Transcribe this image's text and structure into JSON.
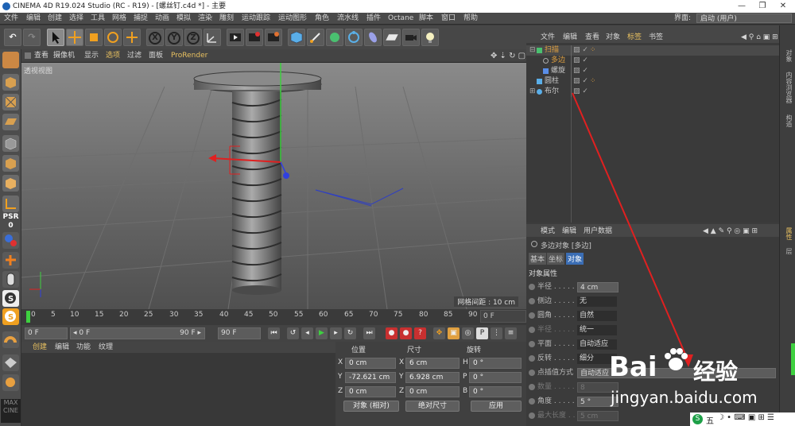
{
  "titlebar": {
    "title": "CINEMA 4D R19.024 Studio (RC - R19) - [螺丝钉.c4d *] - 主要",
    "minimize": "—",
    "maximize": "❐",
    "close": "✕"
  },
  "menu": [
    "文件",
    "编辑",
    "创建",
    "选择",
    "工具",
    "网格",
    "捕捉",
    "动画",
    "模拟",
    "渲染",
    "雕刻",
    "运动跟踪",
    "运动图形",
    "角色",
    "流水线",
    "插件",
    "Octane",
    "脚本",
    "窗口",
    "帮助"
  ],
  "layout": {
    "label": "界面:",
    "value": "启动 (用户)"
  },
  "toolbar": {
    "undo": "↶",
    "redo": "↷",
    "x": "X",
    "y": "Y",
    "z": "Z"
  },
  "viewport": {
    "menu": [
      "查看",
      "摄像机",
      "显示",
      "选项",
      "过滤",
      "面板",
      "ProRender"
    ],
    "label": "透视视图",
    "grid_info": "网格间距 : 10 cm"
  },
  "lefttools": {
    "psr": "PSR",
    "zero": "0"
  },
  "timeline": {
    "ticks": [
      "0",
      "5",
      "10",
      "15",
      "20",
      "25",
      "30",
      "35",
      "40",
      "45",
      "50",
      "55",
      "60",
      "65",
      "70",
      "75",
      "80",
      "85",
      "90"
    ],
    "current": "0 F"
  },
  "transport": {
    "start": "0 F",
    "range_start": "◂ 0 F",
    "range_end": "90 F ▸",
    "end": "90 F"
  },
  "material": {
    "tabs": [
      "创建",
      "编辑",
      "功能",
      "纹理"
    ]
  },
  "coords": {
    "headers": {
      "position": "位置",
      "size": "尺寸",
      "rotation": "旋转"
    },
    "rows": [
      {
        "axis": "X",
        "pos": "0 cm",
        "saxis": "X",
        "size": "6 cm",
        "raxis": "H",
        "rot": "0 °"
      },
      {
        "axis": "Y",
        "pos": "-72.621 cm",
        "saxis": "Y",
        "size": "6.928 cm",
        "raxis": "P",
        "rot": "0 °"
      },
      {
        "axis": "Z",
        "pos": "0 cm",
        "saxis": "Z",
        "size": "0 cm",
        "raxis": "B",
        "rot": "0 °"
      }
    ],
    "mode": "对象 (相对)",
    "size_mode": "绝对尺寸",
    "apply": "应用"
  },
  "objmgr": {
    "tabs": [
      "文件",
      "编辑",
      "查看",
      "对象",
      "标签",
      "书签"
    ],
    "objects": [
      {
        "name": "扫描",
        "indent": 0,
        "color": "#e0a040"
      },
      {
        "name": "多边",
        "indent": 1,
        "color": "#e0a040"
      },
      {
        "name": "螺旋",
        "indent": 1,
        "color": "#c8c8c8"
      },
      {
        "name": "圆柱",
        "indent": 0,
        "color": "#c8c8c8"
      },
      {
        "name": "布尔",
        "indent": 0,
        "color": "#c8c8c8"
      }
    ]
  },
  "attr": {
    "tabs": [
      "模式",
      "编辑",
      "用户数据"
    ],
    "object_title": "多边对象 [多边]",
    "sub_tabs": [
      "基本",
      "坐标",
      "对象"
    ],
    "section": "对象属性",
    "rows": [
      {
        "label": "半径 . . . . . .",
        "value": "4 cm",
        "field": true
      },
      {
        "label": "侧边 . . . . . .",
        "value": "无",
        "field": false
      },
      {
        "label": "圆角 . . . . . .",
        "value": "自然",
        "field": false
      },
      {
        "label": "半径 . . . . . .",
        "value": "统一",
        "field": false
      },
      {
        "label": "平面 . . . . . .",
        "value": "自动适应",
        "field": false
      },
      {
        "label": "反转 . . . . . .",
        "value": "细分",
        "field": false
      },
      {
        "label": "点插值方式",
        "value": "自动适应",
        "field": true
      },
      {
        "label": "数量 . . . . . .",
        "value": "8",
        "field": true
      },
      {
        "label": "角度 . . . . . .",
        "value": "5 °",
        "field": true
      },
      {
        "label": "最大长度 . . .",
        "value": "5 cm",
        "field": true
      }
    ]
  },
  "rightstrip": [
    "对象",
    "内容浏览器",
    "构造",
    "属性",
    "层"
  ],
  "watermark": {
    "brand": "Bai",
    "brand2": "经验",
    "url": "jingyan.baidu.com"
  },
  "taskbar": {
    "label": "五"
  }
}
